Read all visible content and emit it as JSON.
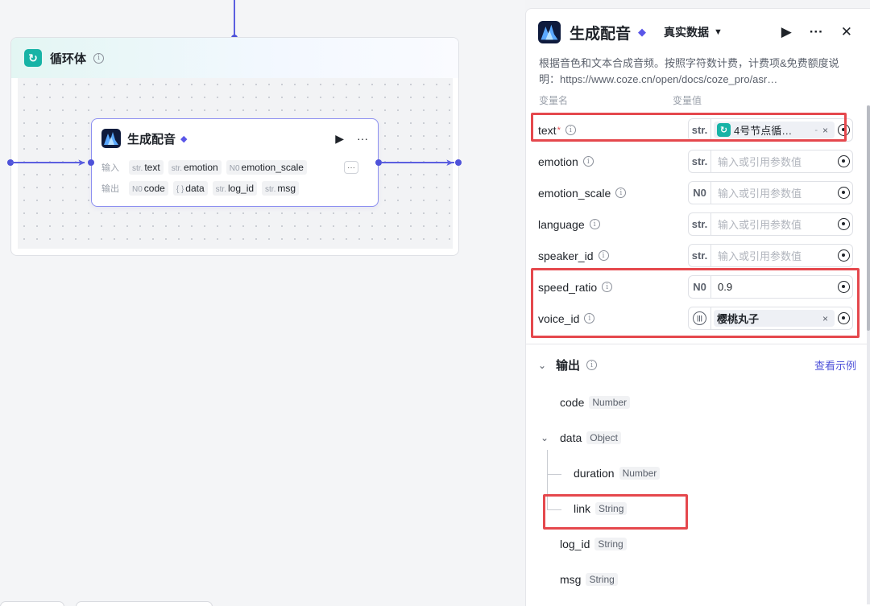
{
  "loop": {
    "title": "循环体",
    "icon": "loop-icon"
  },
  "node": {
    "title": "生成配音",
    "input_label": "输入",
    "output_label": "输出",
    "inputs": [
      {
        "type": "str.",
        "name": "text"
      },
      {
        "type": "str.",
        "name": "emotion"
      },
      {
        "type": "N0",
        "name": "emotion_scale"
      }
    ],
    "outputs": [
      {
        "type": "N0",
        "name": "code"
      },
      {
        "type": "{ }",
        "name": "data"
      },
      {
        "type": "str.",
        "name": "log_id"
      },
      {
        "type": "str.",
        "name": "msg"
      }
    ]
  },
  "panel": {
    "title": "生成配音",
    "mode": "真实数据",
    "description": "根据音色和文本合成音频。按照字符数计费，计费项&免费额度说明：https://www.coze.cn/open/docs/coze_pro/asr…",
    "col_name": "变量名",
    "col_value": "变量值",
    "fields": [
      {
        "name": "text",
        "required": "*",
        "type": "str.",
        "ref": "4号节点循…",
        "ref_extra": "-",
        "remove": "×"
      },
      {
        "name": "emotion",
        "type": "str.",
        "placeholder": "输入或引用参数值"
      },
      {
        "name": "emotion_scale",
        "type": "N0",
        "placeholder": "输入或引用参数值"
      },
      {
        "name": "language",
        "type": "str.",
        "placeholder": "输入或引用参数值"
      },
      {
        "name": "speaker_id",
        "type": "str.",
        "placeholder": "输入或引用参数值"
      },
      {
        "name": "speed_ratio",
        "type": "N0",
        "value": "0.9"
      },
      {
        "name": "voice_id",
        "type": "",
        "ref": "樱桃丸子",
        "remove": "×"
      }
    ],
    "output_title": "输出",
    "see_example": "查看示例",
    "outputs": [
      {
        "name": "code",
        "type": "Number"
      },
      {
        "name": "data",
        "type": "Object"
      },
      {
        "name": "duration",
        "type": "Number"
      },
      {
        "name": "link",
        "type": "String"
      },
      {
        "name": "log_id",
        "type": "String"
      },
      {
        "name": "msg",
        "type": "String"
      }
    ]
  },
  "colors": {
    "accent": "#4e52d9",
    "loop": "#17b3a6",
    "highlight": "#e5484d"
  }
}
